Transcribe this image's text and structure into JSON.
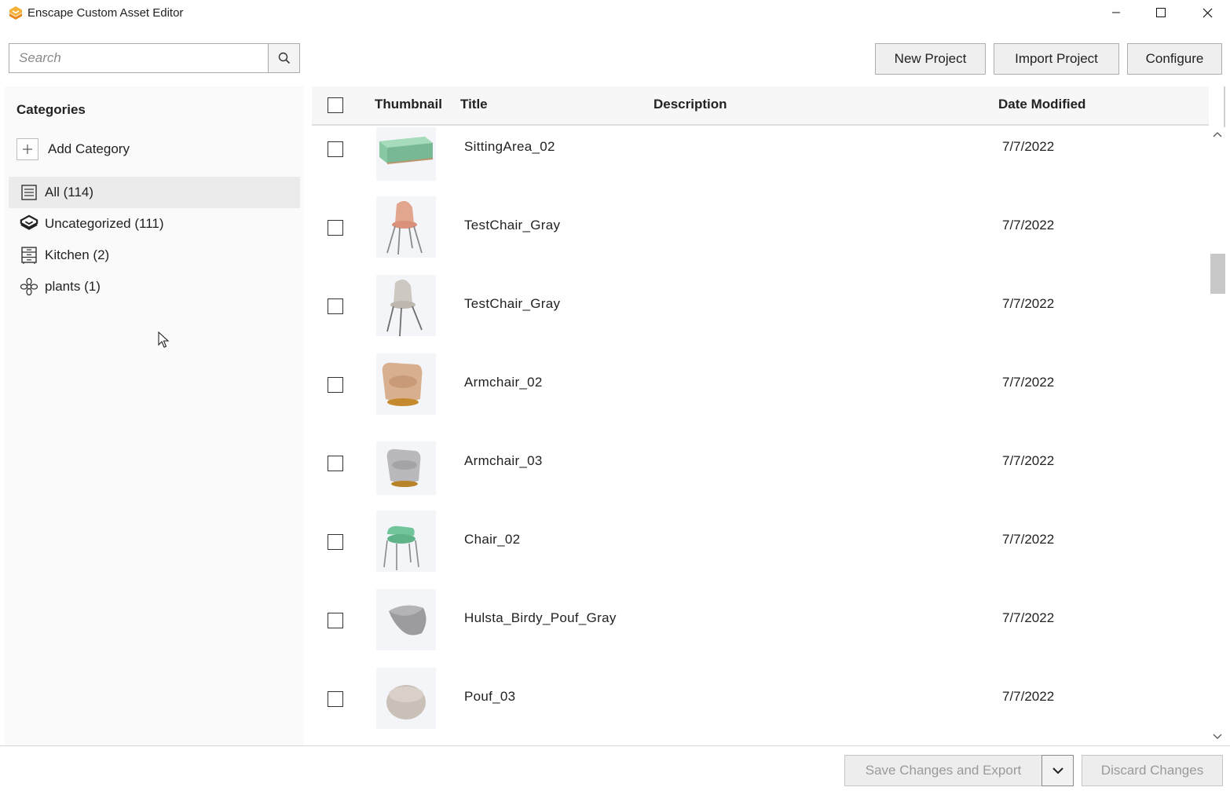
{
  "window": {
    "title": "Enscape Custom Asset Editor",
    "brand_color": "#f29a1f"
  },
  "toolbar": {
    "search_placeholder": "Search",
    "search_icon": "search-icon",
    "new_project": "New Project",
    "import_project": "Import Project",
    "configure": "Configure"
  },
  "sidebar": {
    "title": "Categories",
    "add_category": "Add Category",
    "items": [
      {
        "label": "All (114)",
        "icon": "list-icon",
        "selected": true
      },
      {
        "label": "Uncategorized (111)",
        "icon": "enscape-logo-icon",
        "selected": false
      },
      {
        "label": "Kitchen (2)",
        "icon": "kitchen-cabinet-icon",
        "selected": false
      },
      {
        "label": "plants (1)",
        "icon": "flower-icon",
        "selected": false
      }
    ]
  },
  "table": {
    "columns": {
      "thumbnail": "Thumbnail",
      "title": "Title",
      "description": "Description",
      "date_modified": "Date Modified"
    },
    "rows": [
      {
        "title": "SittingArea_02",
        "description": "",
        "date": "7/7/2022",
        "thumb": "green-sofa"
      },
      {
        "title": "TestChair_Gray",
        "description": "",
        "date": "7/7/2022",
        "thumb": "pink-chair"
      },
      {
        "title": "TestChair_Gray",
        "description": "",
        "date": "7/7/2022",
        "thumb": "gray-chair"
      },
      {
        "title": "Armchair_02",
        "description": "",
        "date": "7/7/2022",
        "thumb": "tan-armchair"
      },
      {
        "title": "Armchair_03",
        "description": "",
        "date": "7/7/2022",
        "thumb": "gray-armchair"
      },
      {
        "title": "Chair_02",
        "description": "",
        "date": "7/7/2022",
        "thumb": "green-chair"
      },
      {
        "title": "Hulsta_Birdy_Pouf_Gray",
        "description": "",
        "date": "7/7/2022",
        "thumb": "gray-pouf"
      },
      {
        "title": "Pouf_03",
        "description": "",
        "date": "7/7/2022",
        "thumb": "beige-pouf"
      }
    ]
  },
  "footer": {
    "save_export": "Save Changes and Export",
    "discard": "Discard Changes"
  }
}
